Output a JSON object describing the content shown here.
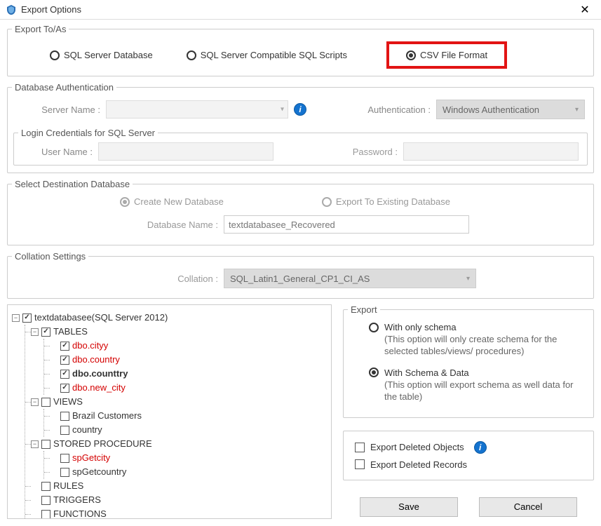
{
  "window": {
    "title": "Export Options"
  },
  "exportTo": {
    "legend": "Export To/As",
    "sql_db": "SQL Server Database",
    "sql_scripts": "SQL Server Compatible SQL Scripts",
    "csv": "CSV File Format"
  },
  "dbAuth": {
    "legend": "Database Authentication",
    "server_label": "Server Name :",
    "server_value": "",
    "auth_label": "Authentication :",
    "auth_value": "Windows Authentication"
  },
  "login": {
    "legend": "Login Credentials for SQL Server",
    "user_label": "User Name :",
    "user_value": "",
    "pass_label": "Password :",
    "pass_value": ""
  },
  "destDb": {
    "legend": "Select Destination Database",
    "create_new": "Create New Database",
    "export_existing": "Export To Existing Database",
    "dbname_label": "Database Name :",
    "dbname_value": "textdatabasee_Recovered"
  },
  "collation": {
    "legend": "Collation Settings",
    "label": "Collation :",
    "value": "SQL_Latin1_General_CP1_CI_AS"
  },
  "tree": {
    "root": "textdatabasee(SQL Server 2012)",
    "tables": {
      "label": "TABLES",
      "items": [
        "dbo.cityy",
        "dbo.country",
        "dbo.counttry",
        "dbo.new_city"
      ],
      "checked": [
        true,
        true,
        true,
        true
      ]
    },
    "views": {
      "label": "VIEWS",
      "items": [
        "Brazil Customers",
        "country"
      ]
    },
    "stored": {
      "label": "STORED PROCEDURE",
      "items": [
        "spGetcity",
        "spGetcountry"
      ]
    },
    "rules": "RULES",
    "triggers": "TRIGGERS",
    "functions": "FUNCTIONS"
  },
  "export": {
    "legend": "Export",
    "schema_only": "With only schema",
    "schema_only_desc": "(This option will only create schema for the  selected tables/views/ procedures)",
    "schema_data": "With Schema & Data",
    "schema_data_desc": "(This option will export schema as well data for the table)"
  },
  "extras": {
    "deleted_objects": "Export Deleted Objects",
    "deleted_records": "Export Deleted Records"
  },
  "buttons": {
    "save": "Save",
    "cancel": "Cancel"
  }
}
